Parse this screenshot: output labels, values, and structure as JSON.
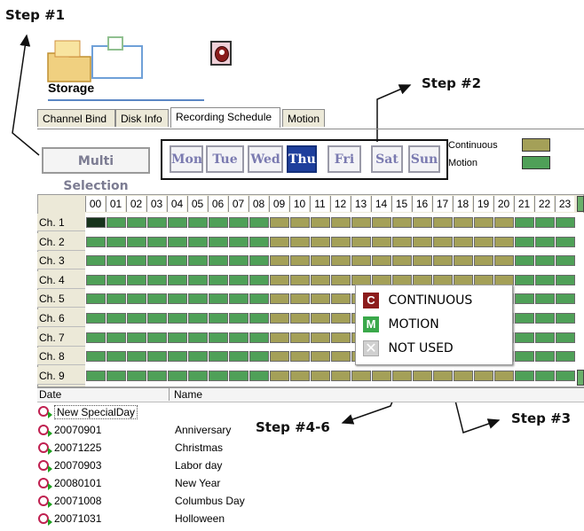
{
  "annotations": {
    "step1": "Step #1",
    "step2": "Step #2",
    "step3": "Step #3",
    "step4_6": "Step #4-6"
  },
  "storage_label": "Storage",
  "tabs": [
    {
      "label": "Channel Bind",
      "active": false
    },
    {
      "label": "Disk Info",
      "active": false
    },
    {
      "label": "Recording Schedule",
      "active": true
    },
    {
      "label": "Motion",
      "active": false
    }
  ],
  "multi_selection_label": "Multi Selection",
  "days": [
    {
      "label": "Mon",
      "active": false
    },
    {
      "label": "Tue",
      "active": false
    },
    {
      "label": "Wed",
      "active": false
    },
    {
      "label": "Thu",
      "active": true
    },
    {
      "label": "Fri",
      "active": false
    },
    {
      "label": "Sat",
      "active": false
    },
    {
      "label": "Sun",
      "active": false
    }
  ],
  "legend": [
    {
      "label": "Continuous",
      "color": "#a4a058"
    },
    {
      "label": "Motion",
      "color": "#4fa058"
    }
  ],
  "schedule": {
    "hours": [
      "00",
      "01",
      "02",
      "03",
      "04",
      "05",
      "06",
      "07",
      "08",
      "09",
      "10",
      "11",
      "12",
      "13",
      "14",
      "15",
      "16",
      "17",
      "18",
      "19",
      "20",
      "21",
      "22",
      "23"
    ],
    "channels": [
      "Ch. 1",
      "Ch. 2",
      "Ch. 3",
      "Ch. 4",
      "Ch. 5",
      "Ch. 6",
      "Ch. 7",
      "Ch. 8",
      "Ch. 9"
    ],
    "continuous_hours": [
      "09",
      "10",
      "11",
      "12",
      "13",
      "14",
      "15",
      "16",
      "17",
      "18",
      "19",
      "20"
    ],
    "selected_cell": {
      "channel": "Ch. 1",
      "hour": "00"
    }
  },
  "context_menu": [
    {
      "key": "C",
      "label": "CONTINUOUS",
      "color": "#8c1c1c"
    },
    {
      "key": "M",
      "label": "MOTION",
      "color": "#3aa84a"
    },
    {
      "key": "",
      "label": "NOT USED",
      "color": "#d0d0d0"
    }
  ],
  "list": {
    "columns": [
      "Date",
      "Name"
    ],
    "new_item": "New SpecialDay",
    "rows": [
      {
        "date": "20070901",
        "name": "Anniversary"
      },
      {
        "date": "20071225",
        "name": "Christmas"
      },
      {
        "date": "20070903",
        "name": "Labor day"
      },
      {
        "date": "20080101",
        "name": "New Year"
      },
      {
        "date": "20071008",
        "name": "Columbus Day"
      },
      {
        "date": "20071031",
        "name": "Holloween"
      }
    ]
  }
}
